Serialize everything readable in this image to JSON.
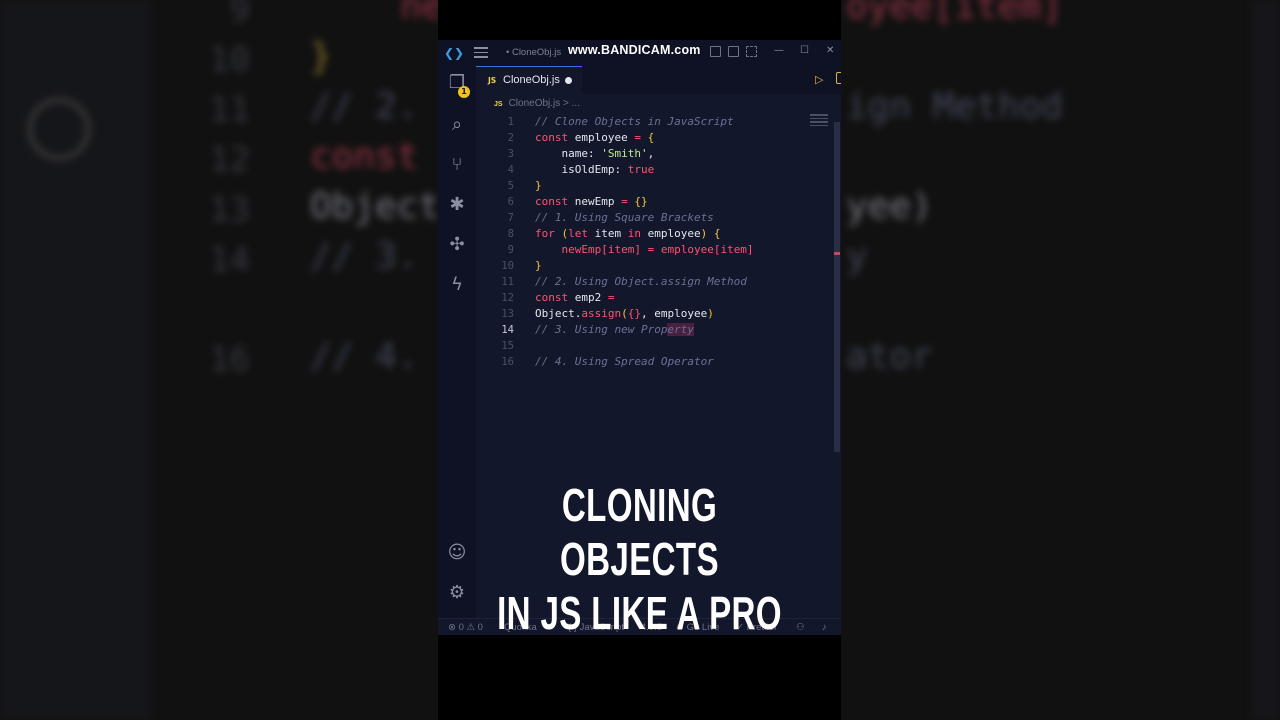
{
  "background": {
    "lines": [
      {
        "num": "9",
        "text": "new",
        "text2": "oyee[item]"
      },
      {
        "num": "10",
        "text": "}"
      },
      {
        "num": "11",
        "text": "// 2.",
        "text2": "ign Method"
      },
      {
        "num": "12",
        "text": "const"
      },
      {
        "num": "13",
        "text": "Object",
        "text2": "yee)"
      },
      {
        "num": "14",
        "text": "// 3.",
        "text2": "y"
      },
      {
        "num": "16",
        "text": "// 4.",
        "text2": "ator"
      }
    ]
  },
  "window": {
    "title": "• CloneObj.js",
    "watermark": "www.BANDICAM.com"
  },
  "tab": {
    "lang_badge": "JS",
    "label": "CloneObj.js"
  },
  "breadcrumb": {
    "badge": "JS",
    "text": "CloneObj.js > ..."
  },
  "activity_bar": {
    "explorer_badge": "1",
    "icons": [
      "files-icon",
      "search-icon",
      "source-control-icon",
      "debug-icon",
      "extensions-icon",
      "lightning-icon",
      "account-icon",
      "settings-gear-icon"
    ]
  },
  "editor": {
    "active_line": 14,
    "lines": [
      {
        "num": "1",
        "segments": [
          {
            "t": "// Clone Objects in JavaScript",
            "c": "c-com"
          }
        ]
      },
      {
        "num": "2",
        "segments": [
          {
            "t": "const",
            "c": "c-kw"
          },
          {
            "t": " employee ",
            "c": "c-var"
          },
          {
            "t": "=",
            "c": "c-op"
          },
          {
            "t": " {",
            "c": "c-br"
          }
        ]
      },
      {
        "num": "3",
        "segments": [
          {
            "t": "    name: ",
            "c": "c-var"
          },
          {
            "t": "'Smith'",
            "c": "c-str"
          },
          {
            "t": ",",
            "c": "c-var"
          }
        ]
      },
      {
        "num": "4",
        "segments": [
          {
            "t": "    isOldEmp: ",
            "c": "c-var"
          },
          {
            "t": "true",
            "c": "c-bool"
          }
        ]
      },
      {
        "num": "5",
        "segments": [
          {
            "t": "}",
            "c": "c-br"
          }
        ]
      },
      {
        "num": "6",
        "segments": [
          {
            "t": "const",
            "c": "c-kw"
          },
          {
            "t": " newEmp ",
            "c": "c-var"
          },
          {
            "t": "=",
            "c": "c-op"
          },
          {
            "t": " {}",
            "c": "c-br"
          }
        ]
      },
      {
        "num": "7",
        "segments": [
          {
            "t": "// 1. Using Square Brackets",
            "c": "c-com"
          }
        ]
      },
      {
        "num": "8",
        "segments": [
          {
            "t": "for",
            "c": "c-kw"
          },
          {
            "t": " (",
            "c": "c-br"
          },
          {
            "t": "let",
            "c": "c-kw"
          },
          {
            "t": " item ",
            "c": "c-var"
          },
          {
            "t": "in",
            "c": "c-kw"
          },
          {
            "t": " employee",
            "c": "c-var"
          },
          {
            "t": ") {",
            "c": "c-br"
          }
        ]
      },
      {
        "num": "9",
        "segments": [
          {
            "t": "    newEmp[item] ",
            "c": "c-acc"
          },
          {
            "t": "=",
            "c": "c-op"
          },
          {
            "t": " employee[item]",
            "c": "c-acc"
          }
        ]
      },
      {
        "num": "10",
        "segments": [
          {
            "t": "}",
            "c": "c-br"
          }
        ]
      },
      {
        "num": "11",
        "segments": [
          {
            "t": "// 2. Using Object.assign Method",
            "c": "c-com"
          }
        ]
      },
      {
        "num": "12",
        "segments": [
          {
            "t": "const",
            "c": "c-kw"
          },
          {
            "t": " emp2 ",
            "c": "c-var"
          },
          {
            "t": "=",
            "c": "c-op"
          }
        ]
      },
      {
        "num": "13",
        "segments": [
          {
            "t": "Object.",
            "c": "c-var"
          },
          {
            "t": "assign",
            "c": "c-fn"
          },
          {
            "t": "(",
            "c": "c-br"
          },
          {
            "t": "{}",
            "c": "c-pr"
          },
          {
            "t": ", employee",
            "c": "c-var"
          },
          {
            "t": ")",
            "c": "c-br"
          }
        ]
      },
      {
        "num": "14",
        "segments": [
          {
            "t": "// 3. Using new Prop",
            "c": "c-com"
          },
          {
            "t": "erty",
            "c": "c-com cursor-hl"
          }
        ]
      },
      {
        "num": "15",
        "segments": []
      },
      {
        "num": "16",
        "segments": [
          {
            "t": "// 4. Using Spread Operator",
            "c": "c-com"
          }
        ]
      }
    ]
  },
  "caption": {
    "line1": "CLONING OBJECTS",
    "line2": "IN JS LIKE A PRO"
  },
  "statusbar": {
    "errors": "⊗ 0 ⚠ 0",
    "quokka": "Quokka",
    "language": "{ } JavaScript",
    "version": "4.9.5",
    "go_live": "Go Live",
    "prettier": "Prettier"
  }
}
